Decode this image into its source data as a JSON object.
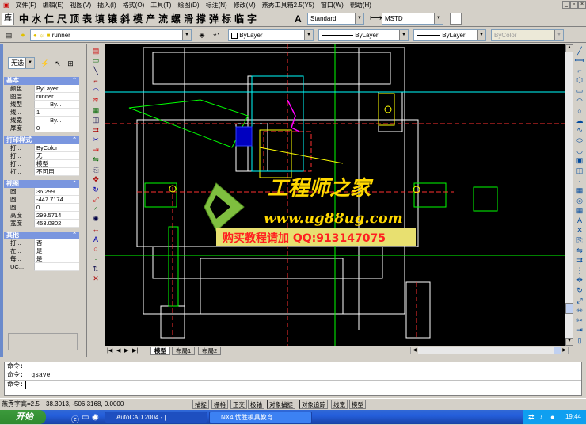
{
  "menu": [
    "文件(F)",
    "编辑(E)",
    "视图(V)",
    "插入(I)",
    "格式(O)",
    "工具(T)",
    "绘图(D)",
    "标注(N)",
    "修改(M)",
    "燕秀工具箱2.5(Y5)",
    "窗口(W)",
    "帮助(H)"
  ],
  "cjk_tools": [
    "中",
    "水",
    "仁",
    "尺",
    "顶",
    "表",
    "填",
    "镶",
    "斜",
    "模",
    "产",
    "流",
    "螺",
    "滑",
    "撑",
    "弹",
    "标",
    "临",
    "字"
  ],
  "toolbar": {
    "text_style": "Standard",
    "dim_style": "MSTD",
    "layer": "runner",
    "color": "ByLayer",
    "linetype": "ByLayer",
    "lineweight": "ByLayer",
    "plotstyle": "ByColor"
  },
  "props": {
    "select": "无选",
    "sections": [
      {
        "title": "基本",
        "rows": [
          [
            "颜色",
            "ByLayer"
          ],
          [
            "图层",
            "runner"
          ],
          [
            "线型",
            "—— By..."
          ],
          [
            "线...",
            "1"
          ],
          [
            "线宽",
            "—— By..."
          ],
          [
            "厚度",
            "0"
          ]
        ]
      },
      {
        "title": "打印样式",
        "rows": [
          [
            "打...",
            "ByColor"
          ],
          [
            "打...",
            "无"
          ],
          [
            "打...",
            "模型"
          ],
          [
            "打...",
            "不可用"
          ]
        ]
      },
      {
        "title": "视图",
        "rows": [
          [
            "圆...",
            "36.299"
          ],
          [
            "圆...",
            "-447.7174"
          ],
          [
            "圆...",
            "0"
          ],
          [
            "高度",
            "299.5714"
          ],
          [
            "宽度",
            "453.0802"
          ]
        ]
      },
      {
        "title": "其他",
        "rows": [
          [
            "打...",
            "否"
          ],
          [
            "在...",
            "是"
          ],
          [
            "每...",
            "是"
          ],
          [
            "UC...",
            ""
          ]
        ]
      }
    ]
  },
  "tabs": [
    "模型",
    "布局1",
    "布局2"
  ],
  "canvas": {
    "wm_title": "工程师之家",
    "wm_url": "www.ug88ug.com",
    "wm_banner": "购买教程请加 QQ:913147075"
  },
  "command": {
    "lines": [
      "命令:",
      "命令:  _qsave",
      "命令:"
    ]
  },
  "status": {
    "label": "燕秀字高=2.5",
    "coords": "38.3013, -506.3168, 0.0000",
    "buttons": [
      "捕捉",
      "栅格",
      "正交",
      "极轴",
      "对象捕捉",
      "对象追踪",
      "线宽",
      "模型"
    ]
  },
  "taskbar": {
    "start": "开始",
    "tasks": [
      "AutoCAD 2004 - [...",
      "NX4 忧胜模具教育..."
    ],
    "clock": "19:44"
  },
  "colors": {
    "canvas_bg": "#000000",
    "taskbar": "#245edb",
    "watermark_yellow": "#ffd800"
  }
}
